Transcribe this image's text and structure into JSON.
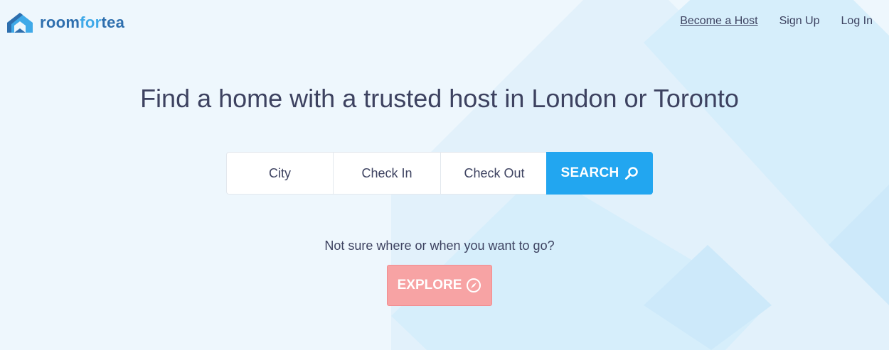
{
  "brand": {
    "logo_left": "room",
    "logo_mid": "for",
    "logo_right": "tea",
    "color_dark": "#2e6fae",
    "color_light": "#3fa9e8"
  },
  "nav": {
    "become_host": "Become a Host",
    "sign_up": "Sign Up",
    "log_in": "Log In"
  },
  "hero": {
    "title": "Find a home with a trusted host in London or Toronto"
  },
  "search": {
    "city_placeholder": "City",
    "check_in_placeholder": "Check In",
    "check_out_placeholder": "Check Out",
    "button_label": "SEARCH",
    "button_icon": "search-icon",
    "button_color": "#22a6f0"
  },
  "explore": {
    "prompt": "Not sure where or when you want to go?",
    "button_label": "EXPLORE",
    "button_icon": "compass-icon",
    "button_color": "#f7a3a4"
  }
}
